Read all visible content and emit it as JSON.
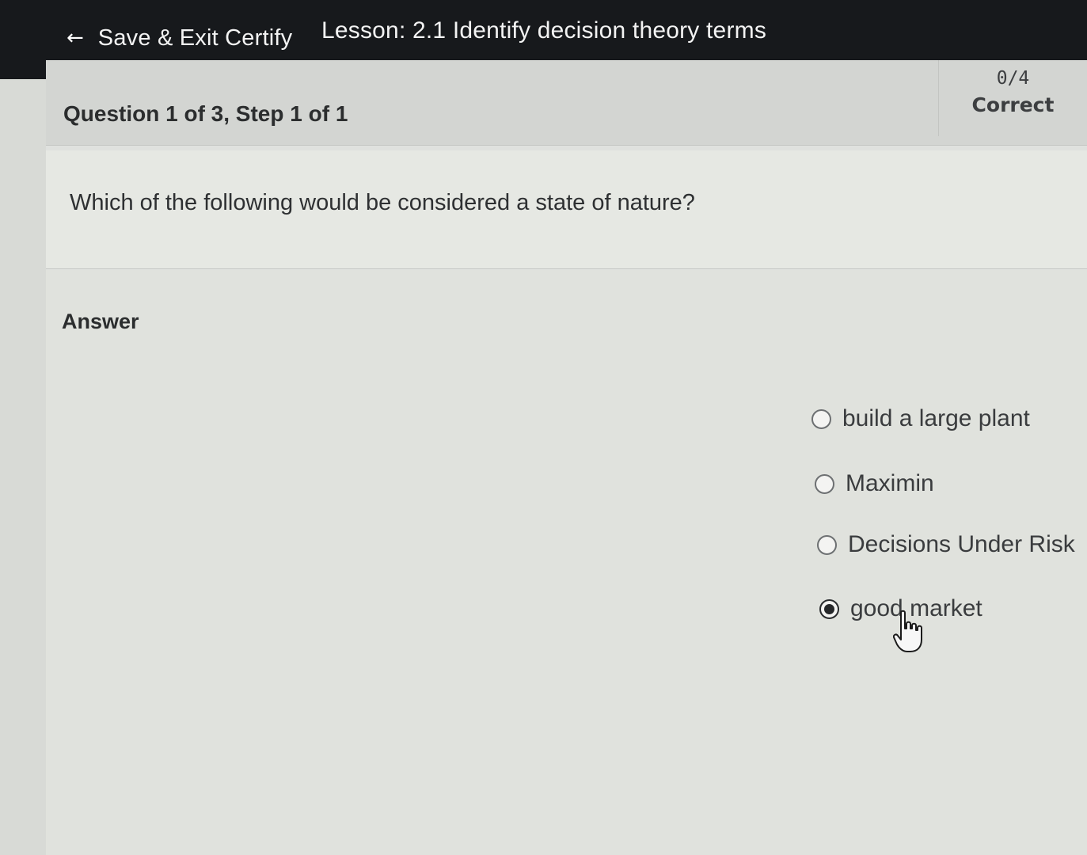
{
  "header": {
    "back_icon": "left-arrow-icon",
    "save_exit_label": "Save & Exit Certify",
    "lesson_title": "Lesson: 2.1 Identify decision theory terms"
  },
  "question": {
    "step_label": "Question 1 of 3, Step 1 of 1",
    "score": "0/4",
    "score_status": "Correct",
    "prompt": "Which of the following would be considered a state of nature?"
  },
  "answer": {
    "label": "Answer",
    "options": [
      {
        "label": "build a large plant",
        "selected": false
      },
      {
        "label": "Maximin",
        "selected": false
      },
      {
        "label": "Decisions Under Risk",
        "selected": false
      },
      {
        "label": "good market",
        "selected": true
      }
    ]
  },
  "cursor": {
    "icon": "hand-pointer-icon"
  }
}
